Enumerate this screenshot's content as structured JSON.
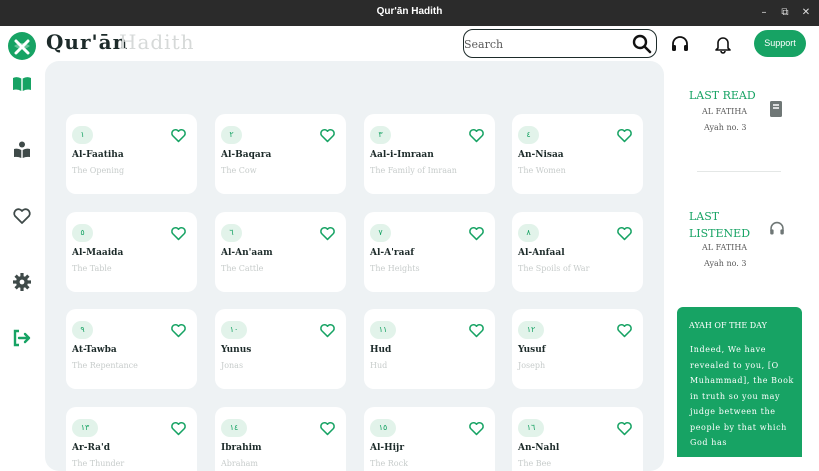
{
  "window": {
    "title": "Qur'ān Hadith"
  },
  "brand": {
    "name": "Qur'ān",
    "subname": "Hadith"
  },
  "search": {
    "placeholder": "Search"
  },
  "header": {
    "support_label": "Support"
  },
  "surahs": [
    {
      "number": "١",
      "name": "Al-Faatiha",
      "meaning": "The Opening"
    },
    {
      "number": "٢",
      "name": "Al-Baqara",
      "meaning": "The Cow"
    },
    {
      "number": "٣",
      "name": "Aal-i-Imraan",
      "meaning": "The Family of Imraan"
    },
    {
      "number": "٤",
      "name": "An-Nisaa",
      "meaning": "The Women"
    },
    {
      "number": "٥",
      "name": "Al-Maaida",
      "meaning": "The Table"
    },
    {
      "number": "٦",
      "name": "Al-An'aam",
      "meaning": "The Cattle"
    },
    {
      "number": "٧",
      "name": "Al-A'raaf",
      "meaning": "The Heights"
    },
    {
      "number": "٨",
      "name": "Al-Anfaal",
      "meaning": "The Spoils of War"
    },
    {
      "number": "٩",
      "name": "At-Tawba",
      "meaning": "The Repentance"
    },
    {
      "number": "١٠",
      "name": "Yunus",
      "meaning": "Jonas"
    },
    {
      "number": "١١",
      "name": "Hud",
      "meaning": "Hud"
    },
    {
      "number": "١٢",
      "name": "Yusuf",
      "meaning": "Joseph"
    },
    {
      "number": "١٣",
      "name": "Ar-Ra'd",
      "meaning": "The Thunder"
    },
    {
      "number": "١٤",
      "name": "Ibrahim",
      "meaning": "Abraham"
    },
    {
      "number": "١٥",
      "name": "Al-Hijr",
      "meaning": "The Rock"
    },
    {
      "number": "١٦",
      "name": "An-Nahl",
      "meaning": "The Bee"
    }
  ],
  "last_read": {
    "title": "LAST READ",
    "surah": "AL FATIHA",
    "ayah": "Ayah no. 3"
  },
  "last_listened": {
    "title": "LAST LISTENED",
    "surah": "AL FATIHA",
    "ayah": "Ayah no. 3"
  },
  "ayah_of_day": {
    "title": "AYAH OF THE DAY",
    "text": "Indeed, We have revealed to you, [O Muhammad], the Book in truth so you may judge between the people by that which God has"
  },
  "colors": {
    "accent": "#17a364",
    "panel": "#eef2f4",
    "dark": "#1d2b2a",
    "muted": "#c7cccb"
  },
  "icons": {
    "logo": "quill-logo-icon",
    "search": "search-icon",
    "headphones": "headphones-icon",
    "bell": "bell-icon",
    "sidebar": [
      "open-book-icon",
      "book-reader-icon",
      "heart-icon",
      "gear-icon",
      "logout-icon"
    ],
    "card_favorite": "heart-outline-icon",
    "last_read": "book-icon",
    "last_listened": "headphones-icon"
  }
}
